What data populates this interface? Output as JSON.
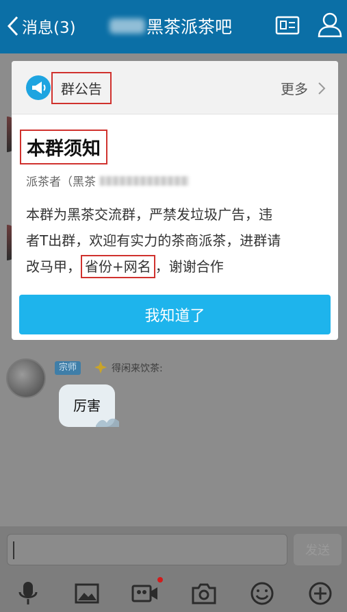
{
  "header": {
    "back_label": "消息(3)",
    "group_name": "黑茶派茶吧"
  },
  "announcement": {
    "section_label": "群公告",
    "more_label": "更多",
    "title": "本群须知",
    "author_prefix": "派茶者（黑茶",
    "body_line1": "本群为黑茶交流群，严禁发垃圾广告，违",
    "body_line2": "者T出群，欢迎有实力的茶商派茶，进群请",
    "body_line3_prefix": "改马甲，",
    "body_line3_highlight": "省份+网名",
    "body_line3_suffix": "，谢谢合作",
    "confirm_label": "我知道了"
  },
  "chat": {
    "message": {
      "badge": "宗师",
      "sender": "得闲来饮茶:",
      "text": "厉害"
    }
  },
  "input": {
    "send_label": "发送"
  },
  "toolbar": {
    "icons": [
      "microphone-icon",
      "image-icon",
      "video-icon",
      "camera-icon",
      "emoji-icon",
      "plus-icon"
    ]
  },
  "colors": {
    "header": "#0b6fa6",
    "confirm_button": "#1eb4ec",
    "highlight_border": "#d0312d"
  }
}
